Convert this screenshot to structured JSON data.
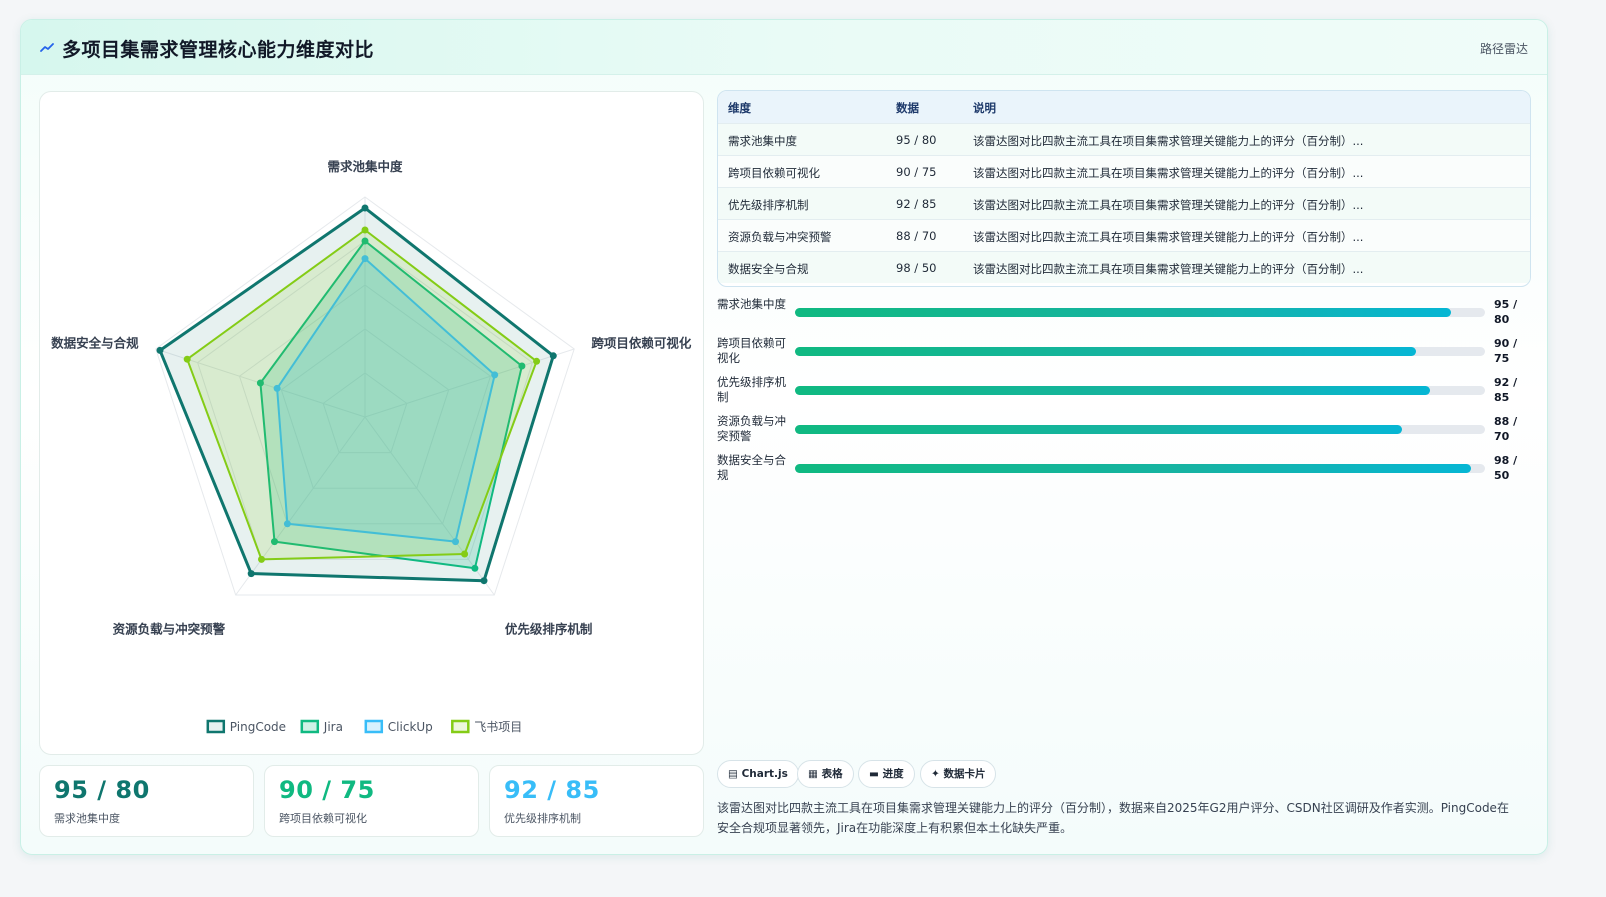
{
  "header": {
    "title": "多项目集需求管理核心能力维度对比",
    "tag": "路径雷达"
  },
  "chart_data": {
    "type": "radar",
    "axes": [
      "需求池集中度",
      "跨项目依赖可视化",
      "优先级排序机制",
      "资源负载与冲突预警",
      "数据安全与合规"
    ],
    "rmax": 100,
    "series": [
      {
        "name": "PingCode",
        "values": [
          95,
          90,
          92,
          88,
          98
        ],
        "color": "#0f766e",
        "fill": "rgba(15,118,110,0.10)"
      },
      {
        "name": "Jira",
        "values": [
          80,
          75,
          85,
          70,
          50
        ],
        "color": "#10b981",
        "fill": "rgba(16,185,129,0.20)"
      },
      {
        "name": "ClickUp",
        "values": [
          72,
          62,
          70,
          60,
          42
        ],
        "color": "#38bdf8",
        "fill": "rgba(56,189,248,0.20)"
      },
      {
        "name": "飞书项目",
        "values": [
          85,
          82,
          77,
          80,
          85
        ],
        "color": "#84cc16",
        "fill": "rgba(132,204,22,0.15)"
      }
    ]
  },
  "table": {
    "headers": [
      "维度",
      "数据",
      "说明"
    ],
    "rows": [
      {
        "dim": "需求池集中度",
        "data": "95 / 80",
        "desc": "该雷达图对比四款主流工具在项目集需求管理关键能力上的评分（百分制）..."
      },
      {
        "dim": "跨项目依赖可视化",
        "data": "90 / 75",
        "desc": "该雷达图对比四款主流工具在项目集需求管理关键能力上的评分（百分制）..."
      },
      {
        "dim": "优先级排序机制",
        "data": "92 / 85",
        "desc": "该雷达图对比四款主流工具在项目集需求管理关键能力上的评分（百分制）..."
      },
      {
        "dim": "资源负载与冲突预警",
        "data": "88 / 70",
        "desc": "该雷达图对比四款主流工具在项目集需求管理关键能力上的评分（百分制）..."
      },
      {
        "dim": "数据安全与合规",
        "data": "98 / 50",
        "desc": "该雷达图对比四款主流工具在项目集需求管理关键能力上的评分（百分制）..."
      }
    ]
  },
  "progress": [
    {
      "label": "需求池集中度",
      "value_text": "95 / 80",
      "fraction": 0.95
    },
    {
      "label": "跨项目依赖可视化",
      "value_text": "90 / 75",
      "fraction": 0.9
    },
    {
      "label": "优先级排序机制",
      "value_text": "92 / 85",
      "fraction": 0.92
    },
    {
      "label": "资源负载与冲突预警",
      "value_text": "88 / 70",
      "fraction": 0.88
    },
    {
      "label": "数据安全与合规",
      "value_text": "98 / 50",
      "fraction": 0.98
    }
  ],
  "kpis": [
    {
      "value": "95 / 80",
      "label": "需求池集中度",
      "color": "#0f766e"
    },
    {
      "value": "90 / 75",
      "label": "跨项目依赖可视化",
      "color": "#10b981"
    },
    {
      "value": "92 / 85",
      "label": "优先级排序机制",
      "color": "#38bdf8"
    }
  ],
  "chips": [
    {
      "icon": "chart-icon",
      "glyph": "▤",
      "label": "Chart.js"
    },
    {
      "icon": "table-icon",
      "glyph": "▦",
      "label": "表格"
    },
    {
      "icon": "progress-icon",
      "glyph": "▬",
      "label": "进度"
    },
    {
      "icon": "sparkle-icon",
      "glyph": "✦",
      "label": "数据卡片"
    }
  ],
  "note": "该雷达图对比四款主流工具在项目集需求管理关键能力上的评分（百分制），数据来自2025年G2用户评分、CSDN社区调研及作者实测。PingCode在安全合规项显著领先，Jira在功能深度上有积累但本土化缺失严重。"
}
